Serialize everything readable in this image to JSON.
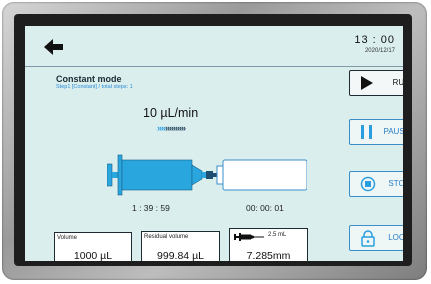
{
  "header": {
    "time": "13 : 00",
    "date": "2020/12/17"
  },
  "mode": {
    "title": "Constant mode",
    "subtitle": "Step1 [Constant] / total steps: 1"
  },
  "flow": {
    "rate": "10 µL/min",
    "chevrons_active": "»»",
    "chevrons_rest": "»»»»»"
  },
  "timers": {
    "elapsed": "1 : 39 : 59",
    "remaining": "00:  00:  01"
  },
  "stats": {
    "volume_label": "Volume",
    "volume_value": "1000 µL",
    "residual_label": "Residual volume",
    "residual_value": "999.84 µL",
    "syringe_size": "2.5 mL",
    "syringe_value": "7.285mm"
  },
  "buttons": {
    "run": "RUN",
    "pause": "PAUSE",
    "stop": "STOP",
    "lock": "LOCK"
  },
  "colors": {
    "screen_bg": "#dbeeee",
    "accent_blue": "#2a9ee0",
    "button_text_blue": "#2a7fc6",
    "syringe_fill": "#2aa6df"
  }
}
